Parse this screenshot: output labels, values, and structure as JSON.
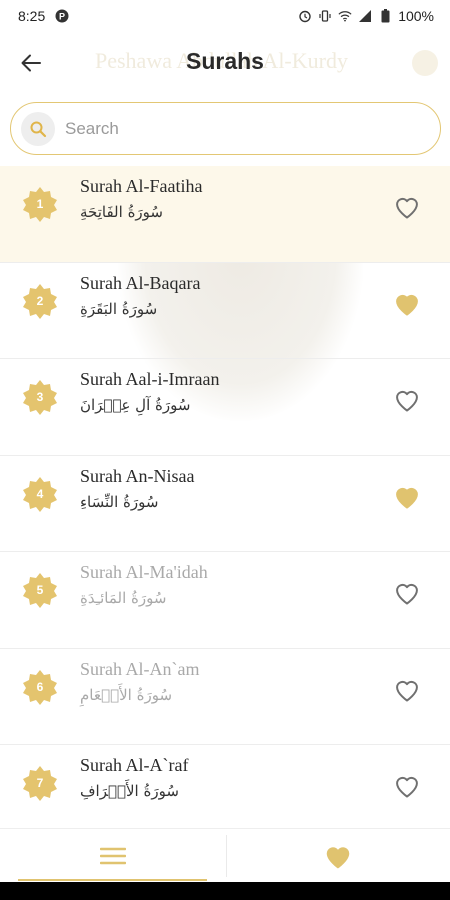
{
  "status_bar": {
    "time": "8:25",
    "battery": "100%",
    "icons": [
      "app-notification-icon",
      "alarm-icon",
      "vibrate-icon",
      "wifi-icon",
      "signal-icon",
      "battery-icon"
    ]
  },
  "app_bar": {
    "title": "Surahs",
    "background_title": "Peshawa Abdullah Al-Kurdy",
    "back_icon": "arrow-left-icon"
  },
  "search": {
    "placeholder": "Search",
    "value": ""
  },
  "surahs": [
    {
      "number": "1",
      "name_en": "Surah Al-Faatiha",
      "name_ar": "سُورَةُ الفَاتِحَةِ",
      "favorite": false
    },
    {
      "number": "2",
      "name_en": "Surah Al-Baqara",
      "name_ar": "سُورَةُ البَقَرَةِ",
      "favorite": true
    },
    {
      "number": "3",
      "name_en": "Surah Aal-i-Imraan",
      "name_ar": "سُورَةُ آلِ عِمۡرَانَ",
      "favorite": false
    },
    {
      "number": "4",
      "name_en": "Surah An-Nisaa",
      "name_ar": "سُورَةُ النِّسَاءِ",
      "favorite": true
    },
    {
      "number": "5",
      "name_en": "Surah Al-Ma'idah",
      "name_ar": "سُورَةُ المَائـِدَةِ",
      "favorite": false
    },
    {
      "number": "6",
      "name_en": "Surah Al-An`am",
      "name_ar": "سُورَةُ الأَنۡعَامِ",
      "favorite": false
    },
    {
      "number": "7",
      "name_en": "Surah Al-A`raf",
      "name_ar": "سُورَةُ الأَعۡرَافِ",
      "favorite": false
    }
  ],
  "bottom_nav": {
    "items": [
      {
        "icon": "menu-icon",
        "active": true
      },
      {
        "icon": "heart-icon",
        "active": false
      }
    ]
  },
  "colors": {
    "accent": "#e0c36f",
    "badge": "#e4c46e",
    "highlight_row": "#fdf8ea",
    "heart_outline": "#707070"
  }
}
